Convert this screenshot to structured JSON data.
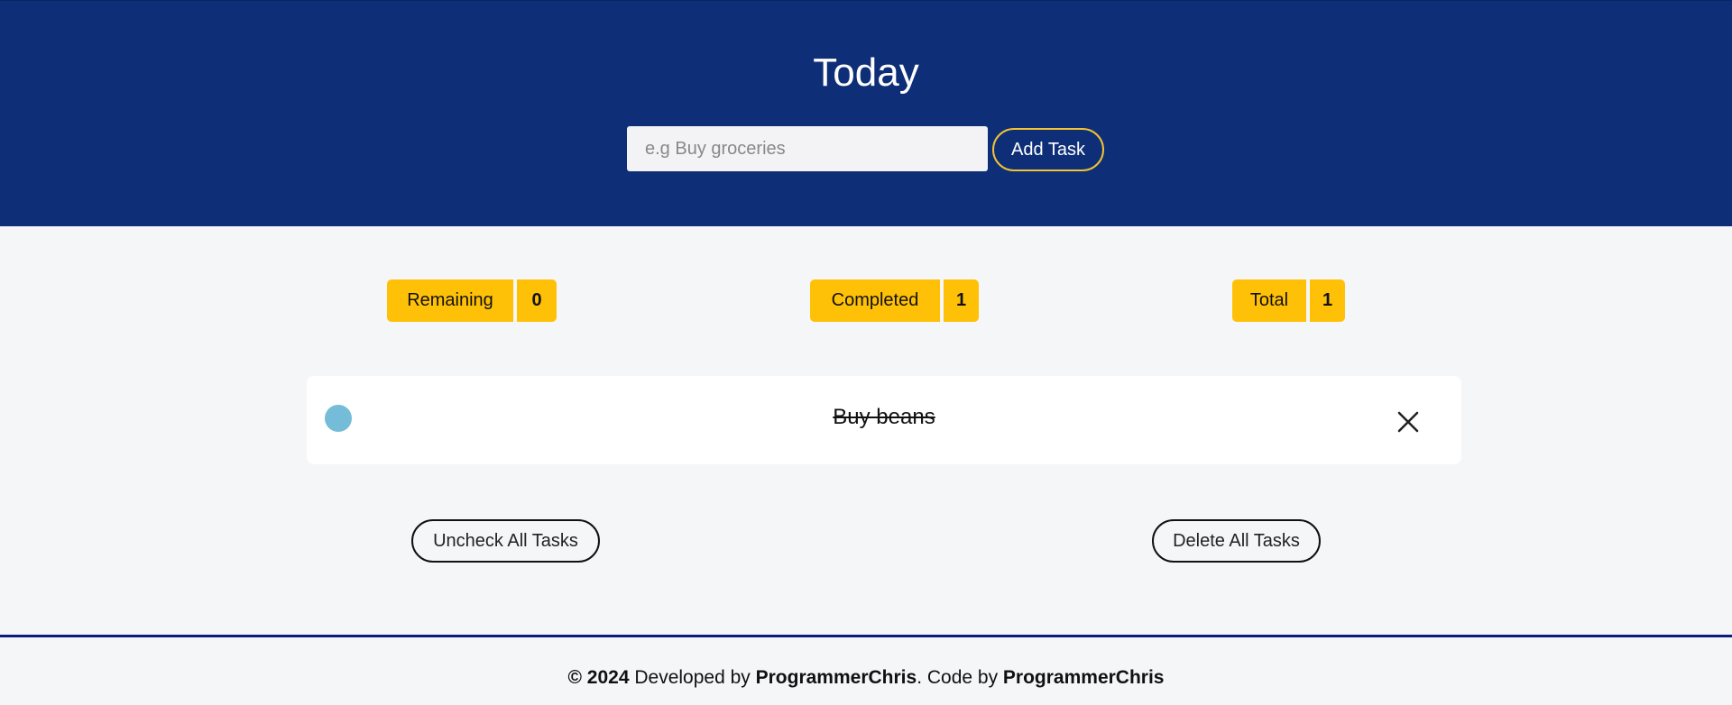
{
  "header": {
    "title": "Today",
    "input_placeholder": "e.g Buy groceries",
    "input_value": "",
    "add_button_label": "Add Task"
  },
  "stats": {
    "remaining": {
      "label": "Remaining",
      "count": "0"
    },
    "completed": {
      "label": "Completed",
      "count": "1"
    },
    "total": {
      "label": "Total",
      "count": "1"
    }
  },
  "tasks": [
    {
      "text": "Buy beans",
      "completed": true,
      "check_color": "#74bcd8"
    }
  ],
  "actions": {
    "uncheck_all_label": "Uncheck All Tasks",
    "delete_all_label": "Delete All Tasks"
  },
  "footer": {
    "copyright": "© 2024",
    "developed_by_text": " Developed by ",
    "developer": "ProgrammerChris",
    "code_by_text": ". Code by ",
    "coder": "ProgrammerChris"
  },
  "colors": {
    "header_bg": "#0e2f77",
    "accent_yellow": "#ffc107",
    "add_button_border": "#f1c232",
    "footer_rule": "#0d1a7e"
  },
  "icons": {
    "task_check": "circle-check-icon",
    "task_delete": "close-icon"
  }
}
